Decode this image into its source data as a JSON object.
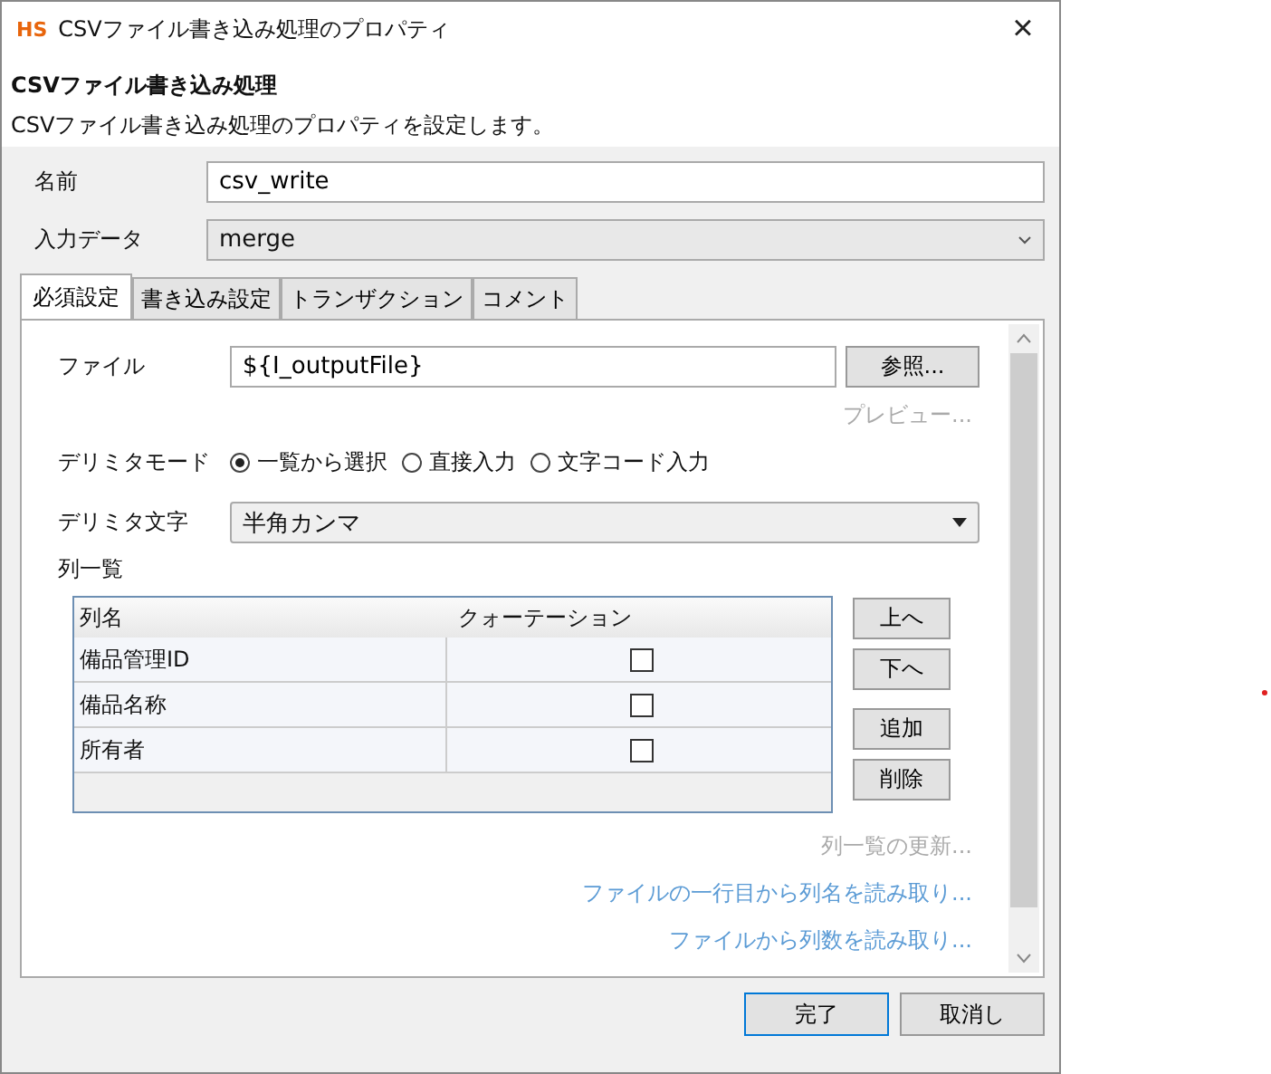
{
  "window": {
    "logo": "HS",
    "title": "CSVファイル書き込み処理のプロパティ",
    "close": "×"
  },
  "header": {
    "title": "CSVファイル書き込み処理",
    "description": "CSVファイル書き込み処理のプロパティを設定します。"
  },
  "name_field": {
    "label": "名前",
    "value": "csv_write"
  },
  "input_data": {
    "label": "入力データ",
    "value": "merge"
  },
  "tabs": [
    {
      "label": "必須設定",
      "selected": true
    },
    {
      "label": "書き込み設定",
      "selected": false
    },
    {
      "label": "トランザクション",
      "selected": false
    },
    {
      "label": "コメント",
      "selected": false
    }
  ],
  "file": {
    "label": "ファイル",
    "value": "${I_outputFile}",
    "button": "参照..."
  },
  "preview_link": {
    "label": "プレビュー...",
    "disabled": true
  },
  "delimiter_mode": {
    "label": "デリミタモード",
    "options": [
      {
        "label": "一覧から選択",
        "selected": true
      },
      {
        "label": "直接入力",
        "selected": false
      },
      {
        "label": "文字コード入力",
        "selected": false
      }
    ]
  },
  "delimiter_char": {
    "label": "デリミタ文字",
    "value": "半角カンマ"
  },
  "column_list": {
    "label": "列一覧",
    "columns": [
      "列名",
      "クォーテーション"
    ],
    "rows": [
      {
        "name": "備品管理ID",
        "quoted": false
      },
      {
        "name": "備品名称",
        "quoted": false
      },
      {
        "name": "所有者",
        "quoted": false
      }
    ],
    "buttons": [
      "上へ",
      "下へ",
      "追加",
      "削除"
    ]
  },
  "links": [
    {
      "label": "列一覧の更新...",
      "disabled": true
    },
    {
      "label": "ファイルの一行目から列名を読み取り...",
      "disabled": false
    },
    {
      "label": "ファイルから列数を読み取り...",
      "disabled": false
    }
  ],
  "footer_buttons": [
    {
      "label": "完了",
      "default": true
    },
    {
      "label": "取消し",
      "default": false
    }
  ]
}
